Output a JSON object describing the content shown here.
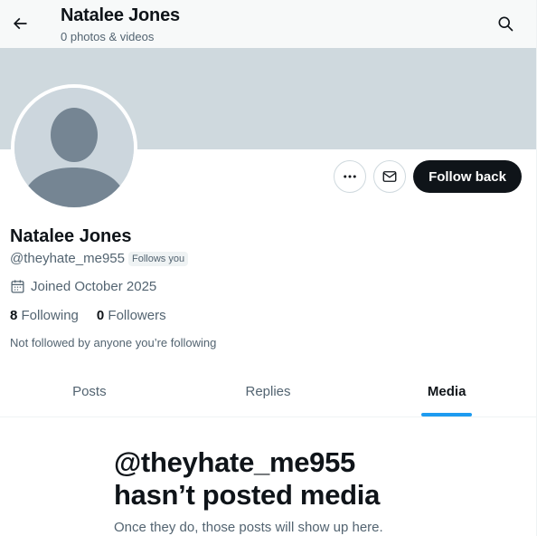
{
  "header": {
    "name": "Natalee Jones",
    "subtitle": "0 photos & videos"
  },
  "profile": {
    "name": "Natalee Jones",
    "handle": "@theyhate_me955",
    "follows_you_badge": "Follows you",
    "joined": "Joined October 2025",
    "following_count": "8",
    "following_label": "Following",
    "followers_count": "0",
    "followers_label": "Followers",
    "mutual_note": "Not followed by anyone you’re following"
  },
  "actions": {
    "follow_label": "Follow back",
    "more_icon": "more-horizontal-icon",
    "message_icon": "envelope-icon"
  },
  "tabs": [
    {
      "label": "Posts",
      "active": false
    },
    {
      "label": "Replies",
      "active": false
    },
    {
      "label": "Media",
      "active": true
    }
  ],
  "empty_state": {
    "title": "@theyhate_me955 hasn’t posted media",
    "subtitle": "Once they do, those posts will show up here."
  },
  "colors": {
    "banner": "#cfd9de",
    "accent": "#1d9bf0",
    "text_primary": "#0f1419",
    "text_secondary": "#536471",
    "button_dark": "#0f1419"
  }
}
